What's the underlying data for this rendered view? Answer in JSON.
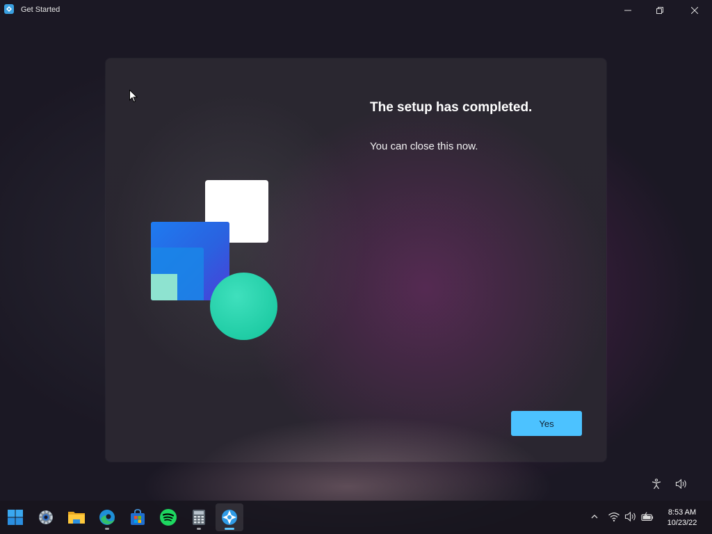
{
  "window": {
    "title": "Get Started",
    "icon": "get-started-app-icon",
    "controls": [
      "minimize-icon",
      "restore-icon",
      "close-icon"
    ]
  },
  "content": {
    "headline": "The setup has completed.",
    "subtext": "You can close this now.",
    "yes_label": "Yes"
  },
  "colors": {
    "accent_button": "#4cc2ff",
    "background": "#1b1824"
  },
  "floating_icons": [
    "accessibility-icon",
    "volume-icon"
  ],
  "taskbar": {
    "items": [
      {
        "name": "start-icon",
        "running": false
      },
      {
        "name": "settings-icon",
        "running": false
      },
      {
        "name": "file-explorer-icon",
        "running": false
      },
      {
        "name": "edge-icon",
        "running": true
      },
      {
        "name": "microsoft-store-icon",
        "running": false
      },
      {
        "name": "spotify-icon",
        "running": false
      },
      {
        "name": "calculator-icon",
        "running": true
      },
      {
        "name": "get-started-icon",
        "running": true,
        "active": true
      }
    ],
    "tray_icons": [
      "chevron-up-icon",
      "wifi-icon",
      "volume-icon",
      "battery-icon"
    ]
  },
  "clock": {
    "time": "8:53 AM",
    "date": "10/23/22"
  }
}
